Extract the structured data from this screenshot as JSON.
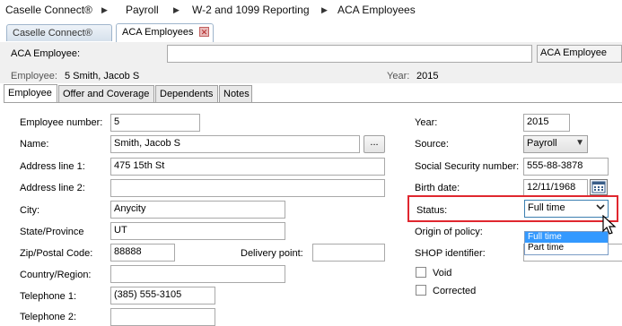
{
  "breadcrumb": [
    "Caselle Connect®",
    "Payroll",
    "W-2 and 1099 Reporting",
    "ACA Employees"
  ],
  "doc_tabs": [
    {
      "label": "Caselle Connect®",
      "active": false
    },
    {
      "label": "ACA Employees",
      "active": true
    }
  ],
  "header": {
    "aca_employee_label": "ACA Employee:",
    "aca_employee_value": "",
    "aca_employee_button": "ACA Employee",
    "employee_label": "Employee:",
    "employee_value": "5  Smith, Jacob S",
    "year_label": "Year:",
    "year_value": "2015"
  },
  "form_tabs": [
    "Employee",
    "Offer and Coverage",
    "Dependents",
    "Notes"
  ],
  "left_fields": {
    "employee_number": {
      "label": "Employee number:",
      "value": "5"
    },
    "name": {
      "label": "Name:",
      "value": "Smith, Jacob S",
      "button": "..."
    },
    "address1": {
      "label": "Address line 1:",
      "value": "475 15th St"
    },
    "address2": {
      "label": "Address line 2:",
      "value": ""
    },
    "city": {
      "label": "City:",
      "value": "Anycity"
    },
    "state": {
      "label": "State/Province",
      "value": "UT"
    },
    "zip": {
      "label": "Zip/Postal Code:",
      "value": "88888"
    },
    "delivery_point": {
      "label": "Delivery point:",
      "value": ""
    },
    "country": {
      "label": "Country/Region:",
      "value": ""
    },
    "telephone1": {
      "label": "Telephone 1:",
      "value": "(385) 555-3105"
    },
    "telephone2": {
      "label": "Telephone 2:",
      "value": ""
    }
  },
  "right_fields": {
    "year": {
      "label": "Year:",
      "value": "2015"
    },
    "source": {
      "label": "Source:",
      "value": "Payroll"
    },
    "ssn": {
      "label": "Social Security number:",
      "value": "555-88-3878"
    },
    "birth_date": {
      "label": "Birth date:",
      "value": "12/11/1968"
    },
    "status": {
      "label": "Status:",
      "value": "Full time",
      "options": [
        "Full time",
        "Part time"
      ]
    },
    "origin_of_policy": {
      "label": "Origin of policy:"
    },
    "shop_identifier": {
      "label": "SHOP identifier:"
    },
    "void": {
      "label": "Void",
      "checked": false
    },
    "corrected": {
      "label": "Corrected",
      "checked": false
    }
  },
  "colors": {
    "highlight": "#e0272f",
    "selection": "#3399ff"
  }
}
